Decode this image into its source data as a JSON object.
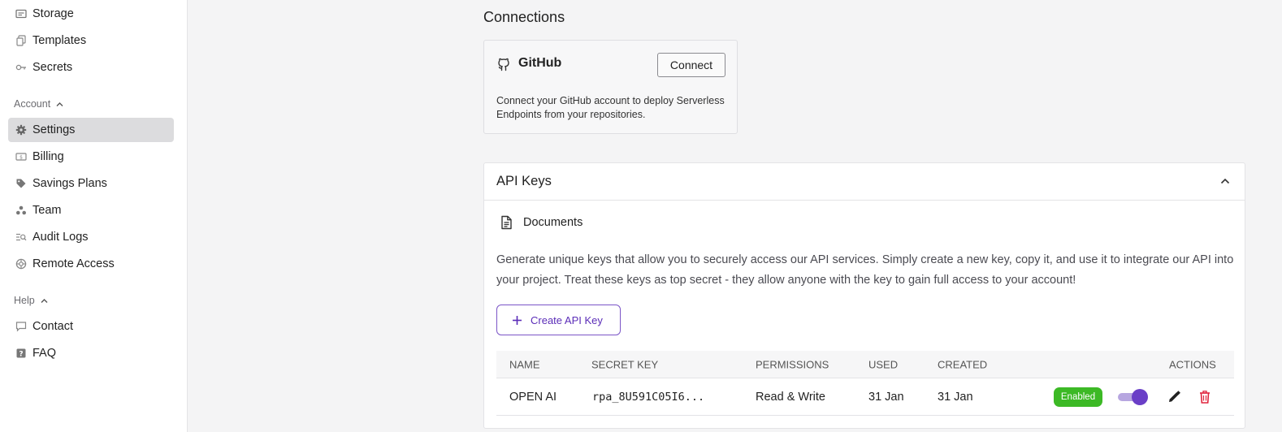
{
  "sidebar": {
    "items_top": [
      {
        "label": "Storage",
        "icon": "storage-icon"
      },
      {
        "label": "Templates",
        "icon": "templates-icon"
      },
      {
        "label": "Secrets",
        "icon": "key-icon"
      }
    ],
    "account_label": "Account",
    "account_items": [
      {
        "label": "Settings",
        "icon": "gear-icon",
        "active": true
      },
      {
        "label": "Billing",
        "icon": "billing-icon"
      },
      {
        "label": "Savings Plans",
        "icon": "tag-icon"
      },
      {
        "label": "Team",
        "icon": "team-icon"
      },
      {
        "label": "Audit Logs",
        "icon": "audit-logs-icon"
      },
      {
        "label": "Remote Access",
        "icon": "remote-access-icon"
      }
    ],
    "help_label": "Help",
    "help_items": [
      {
        "label": "Contact",
        "icon": "chat-icon"
      },
      {
        "label": "FAQ",
        "icon": "question-icon"
      }
    ]
  },
  "connections": {
    "title": "Connections",
    "github": {
      "name": "GitHub",
      "button": "Connect",
      "description": "Connect your GitHub account to deploy Serverless Endpoints from your repositories."
    }
  },
  "api_keys": {
    "title": "API Keys",
    "docs_label": "Documents",
    "description": "Generate unique keys that allow you to securely access our API services. Simply create a new key, copy it, and use it to integrate our API into your project. Treat these keys as top secret - they allow anyone with the key to gain full access to your account!",
    "create_button": "Create API Key",
    "columns": [
      "NAME",
      "SECRET KEY",
      "PERMISSIONS",
      "USED",
      "CREATED",
      "ACTIONS"
    ],
    "rows": [
      {
        "name": "OPEN AI",
        "secret_key": "rpa_8U591C05I6...",
        "permissions": "Read & Write",
        "used": "31 Jan",
        "created": "31 Jan",
        "status": "Enabled",
        "enabled": true
      }
    ]
  },
  "colors": {
    "accent": "#6a3fc7",
    "enabled_badge": "#3cb925",
    "delete": "#e0243d"
  }
}
